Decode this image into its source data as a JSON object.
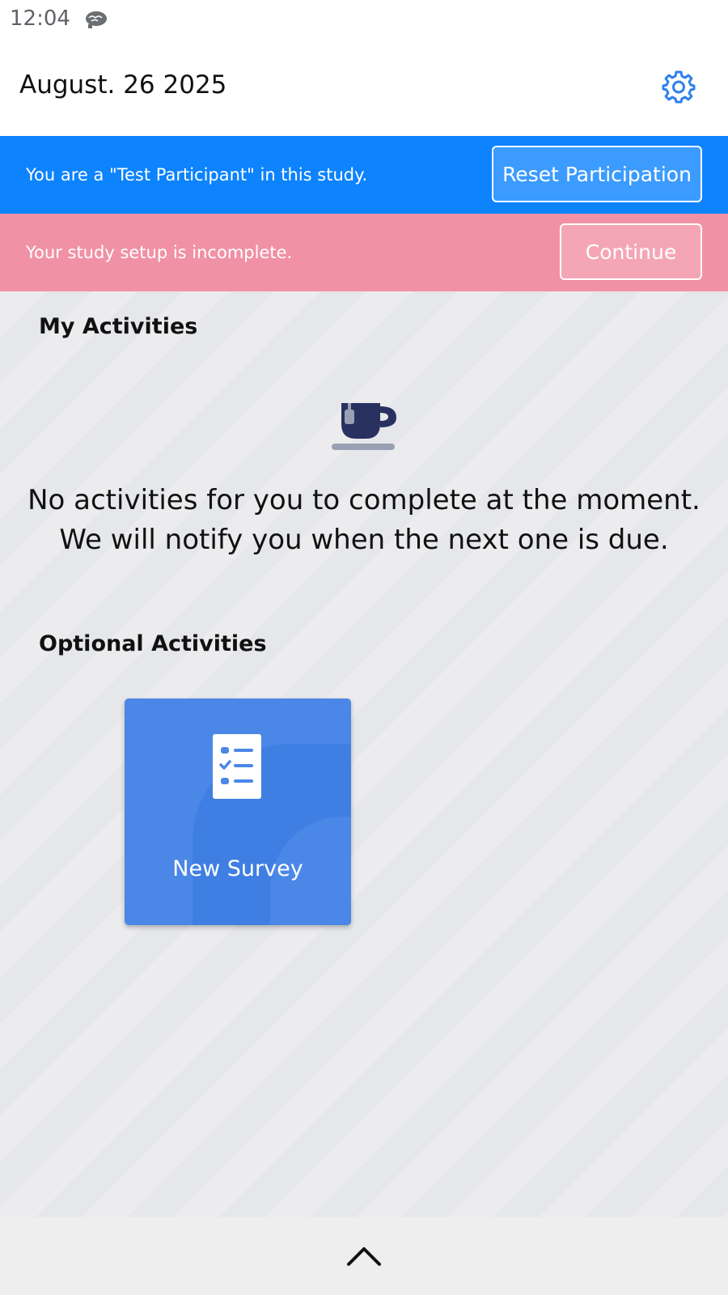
{
  "status_bar": {
    "time": "12:04",
    "notification_icon": "brain-icon"
  },
  "header": {
    "date": "August. 26 2025",
    "settings_icon": "gear-icon"
  },
  "banners": {
    "test_participant": {
      "text": "You are a \"Test Participant\" in this study.",
      "button_label": "Reset Participation",
      "color": "#0d83fd"
    },
    "setup_incomplete": {
      "text": "Your study setup is incomplete.",
      "button_label": "Continue",
      "color": "#f191a5"
    }
  },
  "my_activities": {
    "title": "My Activities",
    "empty_icon": "coffee-cup-icon",
    "empty_line1": "No activities for you to complete at the moment.",
    "empty_line2": "We will notify you when the next one is due."
  },
  "optional_activities": {
    "title": "Optional Activities",
    "items": [
      {
        "label": "New Survey",
        "icon": "checklist-icon",
        "color": "#4b87e6"
      }
    ]
  },
  "bottom_bar": {
    "icon": "chevron-up-icon"
  }
}
